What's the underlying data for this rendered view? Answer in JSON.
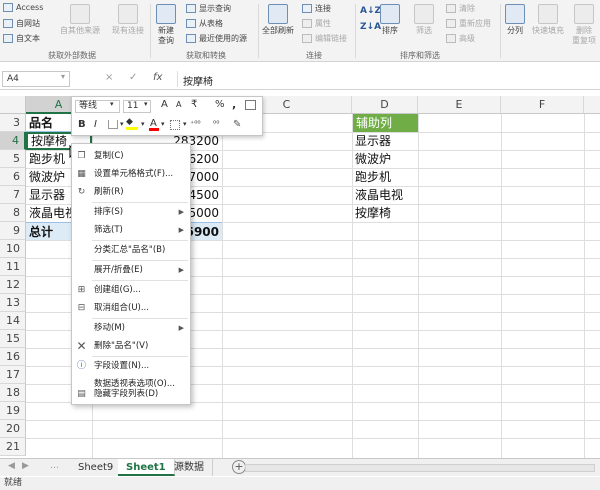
{
  "ribbon": {
    "get_external": {
      "access": "Access",
      "website": "自网站",
      "text": "自文本",
      "other_sources": "自其他来源",
      "existing_connections": "现有连接",
      "group": "获取外部数据"
    },
    "get_transform": {
      "new_query": "新建\n查询",
      "show_queries": "显示查询",
      "from_table": "从表格",
      "recent_sources": "最近使用的源",
      "group": "获取和转换"
    },
    "connections": {
      "refresh_all": "全部刷新",
      "connections": "连接",
      "properties": "属性",
      "edit_links": "编辑链接",
      "group": "连接"
    },
    "sort_filter": {
      "sort": "排序",
      "filter": "筛选",
      "clear": "清除",
      "reapply": "重新应用",
      "advanced": "高级",
      "group": "排序和筛选"
    },
    "data_tools": {
      "split": "分列",
      "flash_fill": "快速填充",
      "remove_dup": "删除\n重复项"
    }
  },
  "formula_bar": {
    "name_box": "A4",
    "cancel": "×",
    "enter": "✓",
    "fx": "fx",
    "value": "按摩椅"
  },
  "columns": [
    "A",
    "B",
    "C",
    "D",
    "E",
    "F"
  ],
  "rows": [
    "3",
    "4",
    "5",
    "6",
    "7",
    "8",
    "9",
    "10",
    "11",
    "12",
    "13",
    "14",
    "15",
    "16",
    "17",
    "18",
    "19",
    "20",
    "21"
  ],
  "cells": {
    "a3": "品名",
    "a4": "按摩椅",
    "a5": "跑步机",
    "a6": "微波炉",
    "a7": "显示器",
    "a8": "液晶电视",
    "a9": "总计",
    "b4": "283200",
    "b5": "76200",
    "b6": "47000",
    "b7": "34500",
    "b8": "35000",
    "b9": "5900",
    "d3": "辅助列",
    "d4": "显示器",
    "d5": "微波炉",
    "d6": "跑步机",
    "d7": "液晶电视",
    "d8": "按摩椅"
  },
  "mini_toolbar": {
    "font": "等线",
    "size": "11",
    "grow": "A",
    "shrink": "A",
    "currency": "₹",
    "percent": "%",
    "comma": ",",
    "bold": "B",
    "italic": "I",
    "font_color": "A",
    "inc_decimal": "⁺⁰⁰",
    "dec_decimal": "⁰⁰"
  },
  "context_menu": [
    "复制(C)",
    "设置单元格格式(F)...",
    "刷新(R)",
    "排序(S)",
    "筛选(T)",
    "分类汇总\"品名\"(B)",
    "展开/折叠(E)",
    "创建组(G)...",
    "取消组合(U)...",
    "移动(M)",
    "删除\"品名\"(V)",
    "字段设置(N)...",
    "数据透视表选项(O)...",
    "隐藏字段列表(D)"
  ],
  "tabs": {
    "sheets": [
      "Sheet9",
      "Sheet1",
      "源数据"
    ],
    "active": "Sheet1",
    "add": "+"
  },
  "status": "就绪",
  "colors": {
    "accent": "#217346",
    "helper_header_bg": "#70ad47",
    "total_row_bg": "#ddebf7",
    "selected_header_bg": "#d2d2d2"
  }
}
